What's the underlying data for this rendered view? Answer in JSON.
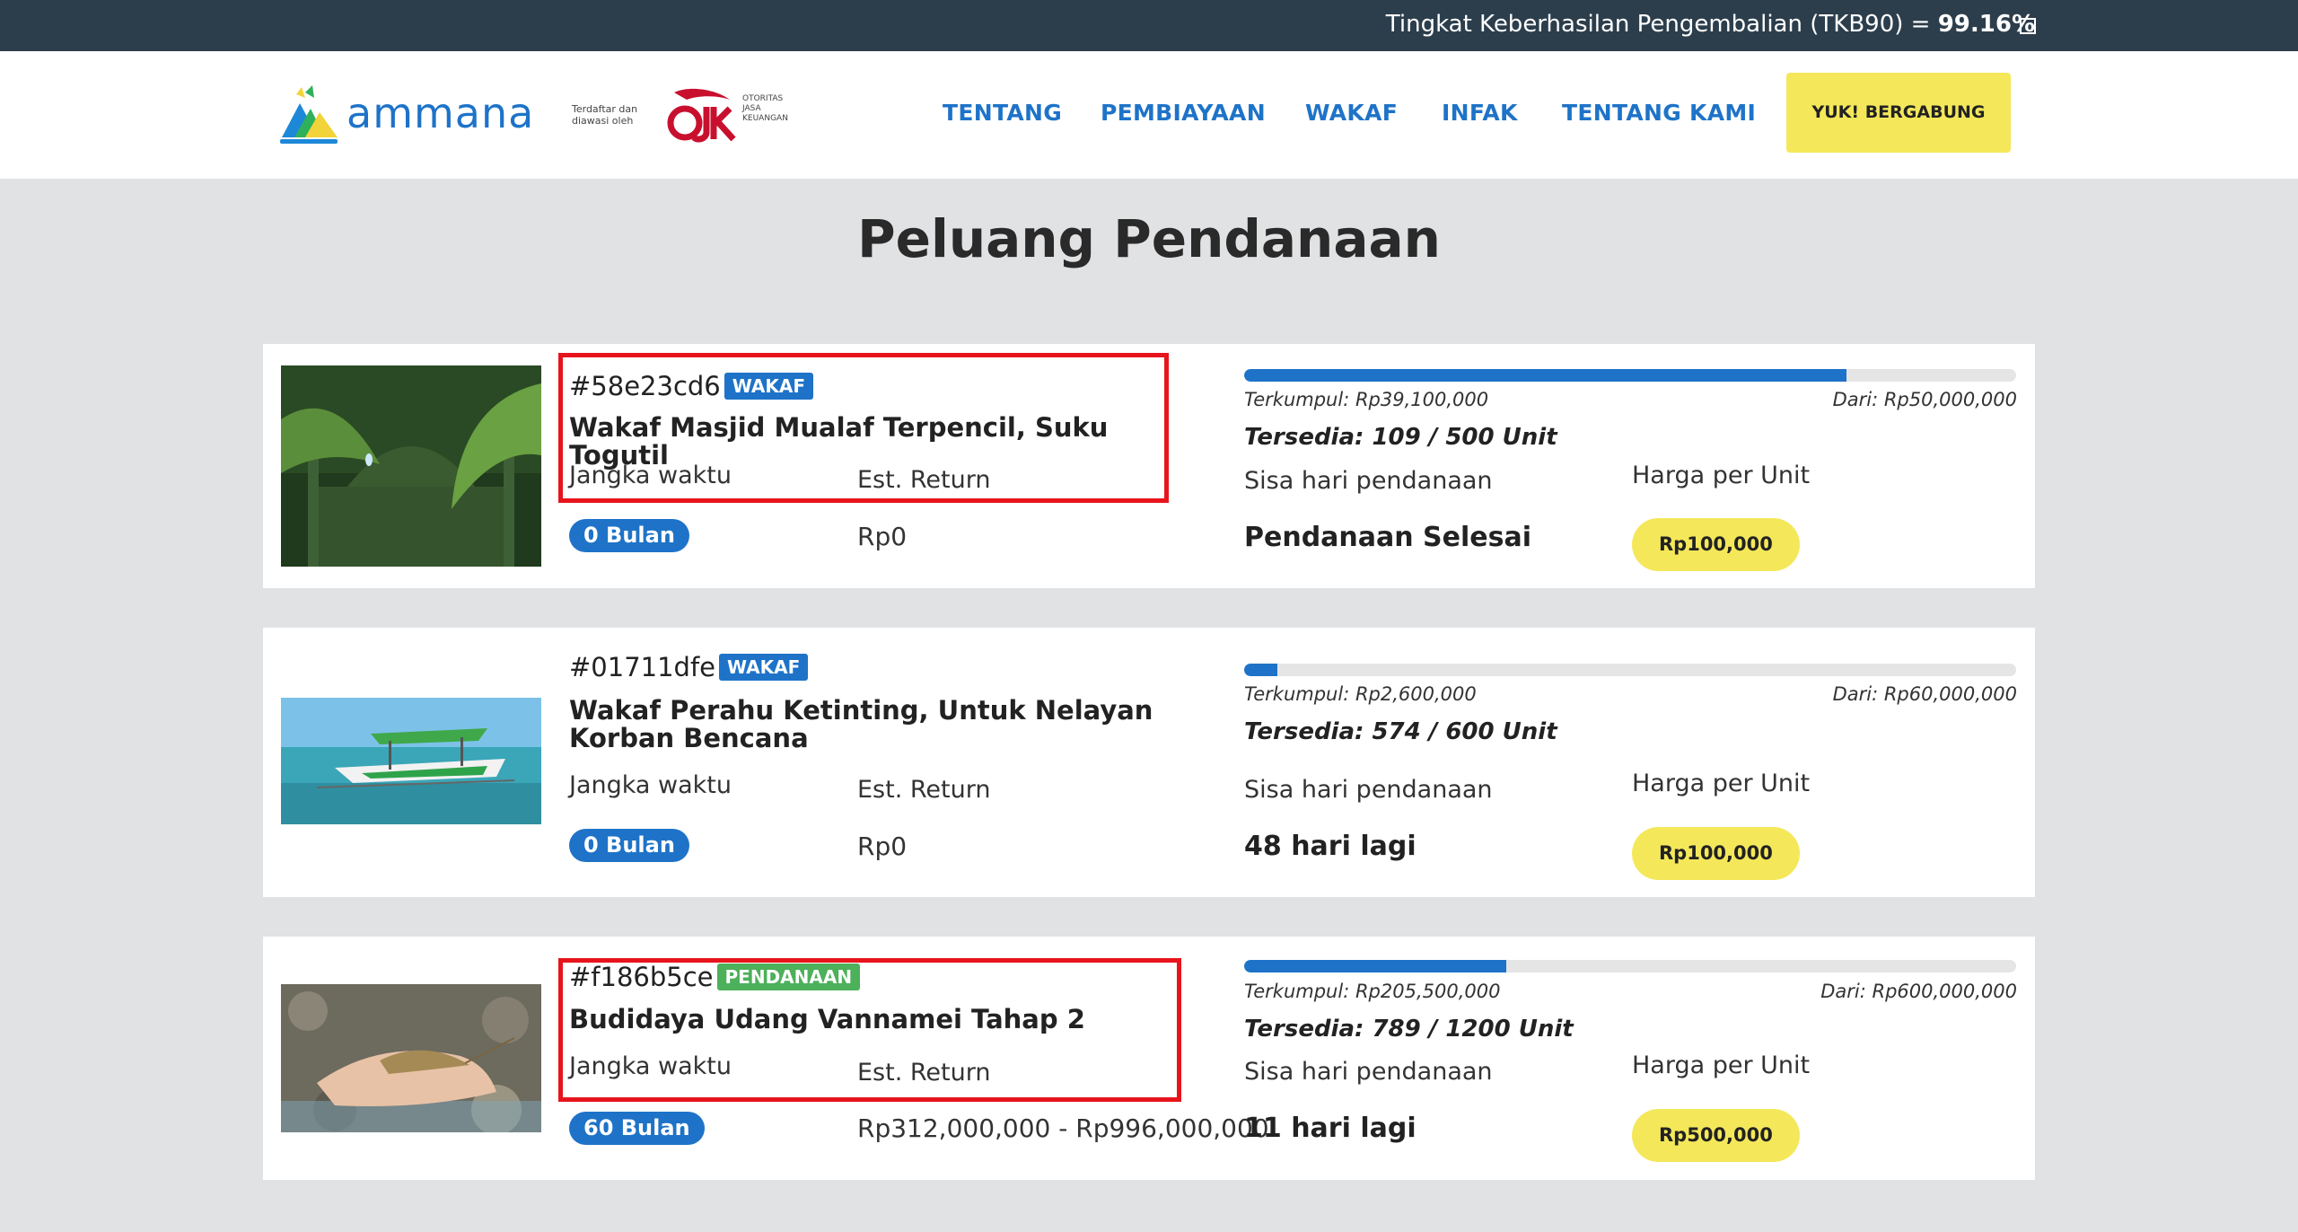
{
  "topbar": {
    "tkb_label": "Tingkat Keberhasilan Pengembalian (TKB90) = ",
    "tkb_value": "99.16%"
  },
  "header": {
    "logo_text": "ammana",
    "ojk_left": "Terdaftar dan diawasi oleh",
    "ojk_mark": "OJK",
    "ojk_right": "OTORITAS JASA KEUANGAN",
    "nav": [
      "TENTANG",
      "PEMBIAYAAN",
      "WAKAF",
      "INFAK",
      "TENTANG KAMI"
    ],
    "cta": "YUK! BERGABUNG"
  },
  "page_title": "Peluang Pendanaan",
  "labels": {
    "jangka": "Jangka waktu",
    "est_return": "Est. Return",
    "sisa_hari": "Sisa hari pendanaan",
    "harga_unit": "Harga per Unit"
  },
  "projects": [
    {
      "code": "#58e23cd6",
      "badge": "WAKAF",
      "title": "Wakaf Masjid Mualaf Terpencil, Suku Togutil",
      "duration": "0 Bulan",
      "est_return": "Rp0",
      "progress": 0.78,
      "terkumpul": "Terkumpul: Rp39,100,000",
      "dari": "Dari: Rp50,000,000",
      "tersedia": "Tersedia: 109 / 500 Unit",
      "status": "Pendanaan Selesai",
      "price": "Rp100,000"
    },
    {
      "code": "#01711dfe",
      "badge": "WAKAF",
      "title": "Wakaf Perahu Ketinting, Untuk Nelayan Korban Bencana",
      "duration": "0 Bulan",
      "est_return": "Rp0",
      "progress": 0.043,
      "terkumpul": "Terkumpul: Rp2,600,000",
      "dari": "Dari: Rp60,000,000",
      "tersedia": "Tersedia: 574 / 600 Unit",
      "status": "48 hari lagi",
      "price": "Rp100,000"
    },
    {
      "code": "#f186b5ce",
      "badge": "PENDANAAN",
      "title": "Budidaya Udang Vannamei Tahap 2",
      "duration": "60 Bulan",
      "est_return": "Rp312,000,000 - Rp996,000,000",
      "progress": 0.34,
      "terkumpul": "Terkumpul: Rp205,500,000",
      "dari": "Dari: Rp600,000,000",
      "tersedia": "Tersedia: 789 / 1200 Unit",
      "status": "11 hari lagi",
      "price": "Rp500,000"
    }
  ],
  "colors": {
    "topbar": "#2c3e4c",
    "brand_blue": "#1e73c8",
    "cta_yellow": "#f4e85a",
    "badge_green": "#4db05a",
    "highlight_red": "#e8141c"
  }
}
